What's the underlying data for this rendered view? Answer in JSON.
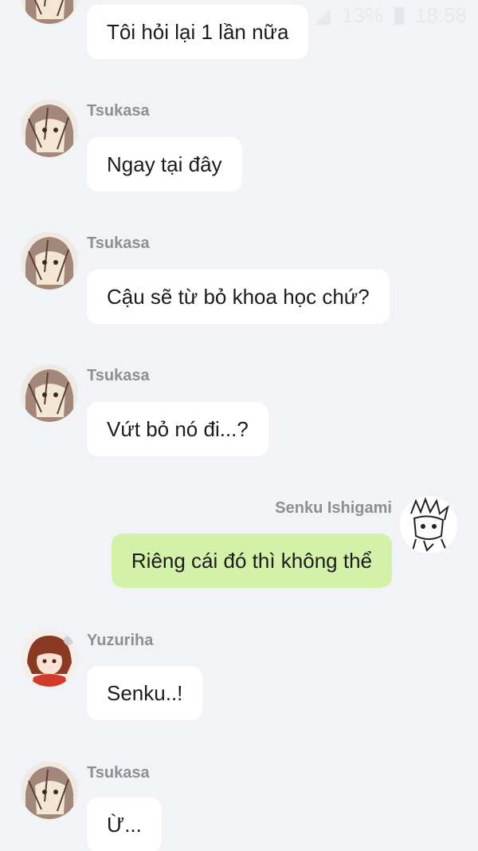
{
  "status_bar": {
    "battery": "13%",
    "time": "18:58"
  },
  "messages": [
    {
      "sender": "",
      "text": "Tôi hỏi lại 1 lần nữa",
      "side": "left",
      "avatar": "tsukasa-avatar"
    },
    {
      "sender": "Tsukasa",
      "text": "Ngay tại đây",
      "side": "left",
      "avatar": "tsukasa-avatar"
    },
    {
      "sender": "Tsukasa",
      "text": "Cậu sẽ từ bỏ khoa học chứ?",
      "side": "left",
      "avatar": "tsukasa-avatar"
    },
    {
      "sender": "Tsukasa",
      "text": "Vứt bỏ nó đi...?",
      "side": "left",
      "avatar": "tsukasa-avatar"
    },
    {
      "sender": "Senku Ishigami",
      "text": "Riêng cái đó thì không thể",
      "side": "right",
      "avatar": "senku-avatar"
    },
    {
      "sender": "Yuzuriha",
      "text": "Senku..!",
      "side": "left",
      "avatar": "yuzuriha-avatar"
    },
    {
      "sender": "Tsukasa",
      "text": "Ừ...",
      "side": "left",
      "avatar": "tsukasa-avatar"
    }
  ],
  "colors": {
    "background": "#f2f3f6",
    "bubble_incoming": "#ffffff",
    "bubble_outgoing": "#d3f1a8",
    "sender_name": "#8b8f96",
    "text": "#1c1c1c"
  }
}
